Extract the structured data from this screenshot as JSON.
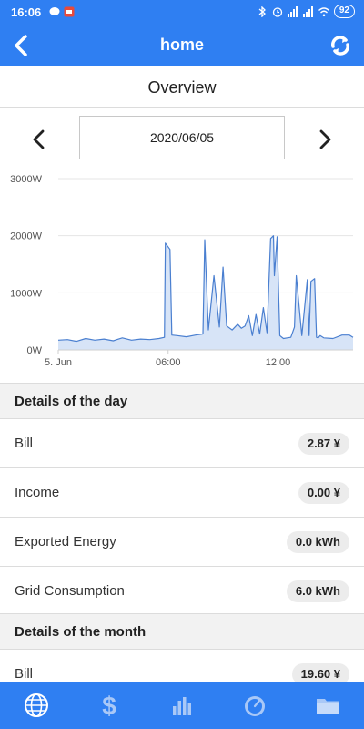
{
  "status_bar": {
    "time": "16:06",
    "battery": "92",
    "icons": [
      "chat-icon",
      "app-icon",
      "bluetooth-icon",
      "alarm-icon",
      "signal-icon",
      "signal-hd-icon",
      "wifi-icon"
    ]
  },
  "header": {
    "title": "home",
    "back_icon": "back-arrow-icon",
    "refresh_icon": "refresh-icon"
  },
  "overview": {
    "title": "Overview",
    "date": "2020/06/05"
  },
  "chart_data": {
    "type": "area",
    "title": "",
    "xlabel": "",
    "ylabel": "",
    "y_tick_labels": [
      "0W",
      "1000W",
      "2000W",
      "3000W"
    ],
    "ylim": [
      0,
      3000
    ],
    "x_tick_labels": [
      "5. Jun",
      "06:00",
      "12:00"
    ],
    "x_tick_hours": [
      0,
      6,
      12
    ],
    "xlim_hours": [
      0,
      16.1
    ],
    "grid": true,
    "series_color": "#4a7fd0",
    "fill_color": "#d7e4f7",
    "x": [
      0,
      0.5,
      1,
      1.5,
      2,
      2.5,
      3,
      3.5,
      4,
      4.5,
      5,
      5.5,
      5.8,
      5.85,
      6.1,
      6.2,
      6.5,
      7,
      7.5,
      7.9,
      8.0,
      8.2,
      8.5,
      8.8,
      9.0,
      9.2,
      9.5,
      9.8,
      10.0,
      10.2,
      10.4,
      10.6,
      10.8,
      11.0,
      11.2,
      11.4,
      11.6,
      11.75,
      11.8,
      11.95,
      12.1,
      12.3,
      12.5,
      12.7,
      12.9,
      13.0,
      13.3,
      13.6,
      13.7,
      13.8,
      14.0,
      14.1,
      14.2,
      14.3,
      14.5,
      15.0,
      15.5,
      15.9,
      16.1
    ],
    "values": [
      170,
      180,
      150,
      200,
      170,
      190,
      160,
      210,
      170,
      190,
      180,
      200,
      220,
      1870,
      1760,
      260,
      250,
      230,
      260,
      280,
      1930,
      350,
      1300,
      400,
      1450,
      420,
      350,
      450,
      380,
      420,
      600,
      250,
      620,
      280,
      740,
      300,
      1950,
      2000,
      1300,
      1980,
      250,
      200,
      210,
      220,
      400,
      1300,
      250,
      1230,
      250,
      1200,
      1250,
      220,
      210,
      250,
      210,
      200,
      260,
      260,
      220
    ]
  },
  "day": {
    "heading": "Details of the day",
    "rows": [
      {
        "label": "Bill",
        "value": "2.87 ¥"
      },
      {
        "label": "Income",
        "value": "0.00 ¥"
      },
      {
        "label": "Exported Energy",
        "value": "0.0 kWh"
      },
      {
        "label": "Grid Consumption",
        "value": "6.0 kWh"
      }
    ]
  },
  "month": {
    "heading": "Details of the month",
    "rows": [
      {
        "label": "Bill",
        "value": "19.60 ¥"
      }
    ]
  },
  "bottom_nav": {
    "tabs": [
      "globe-icon",
      "dollar-icon",
      "bar-chart-icon",
      "gauge-icon",
      "folder-icon"
    ]
  }
}
